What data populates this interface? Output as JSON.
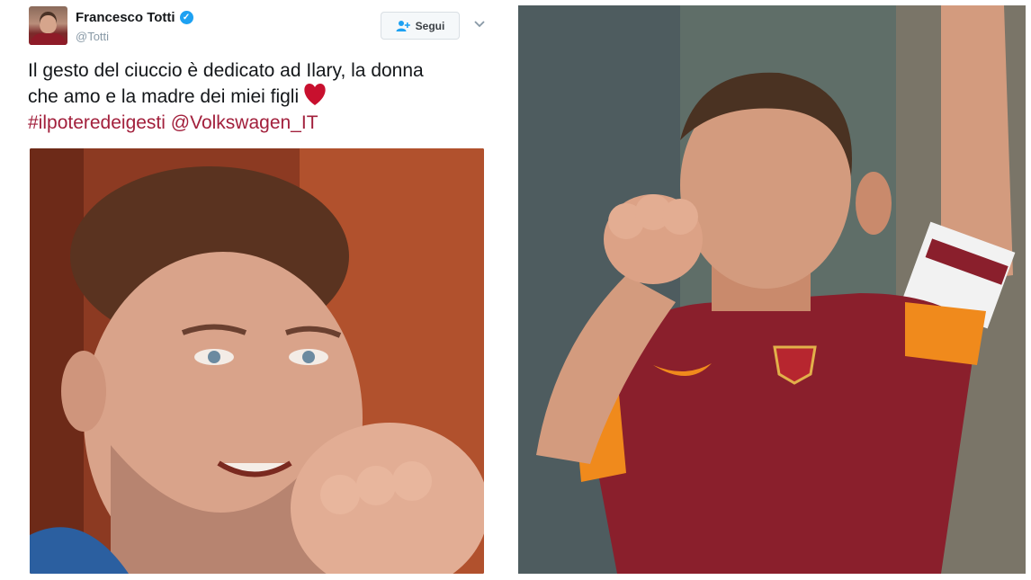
{
  "tweet": {
    "display_name": "Francesco Totti",
    "handle": "@Totti",
    "follow_label": "Segui",
    "text_lines": [
      "Il gesto del ciuccio è dedicato ad Ilary, la donna",
      "che amo e la madre dei miei figli"
    ],
    "hashtag": "#ilpoteredeigesti",
    "mention": "@Volkswagen_IT"
  },
  "icons": {
    "verified": "verified-badge-icon",
    "follow": "add-user-icon",
    "caret": "chevron-down-icon",
    "heart": "red-heart-emoji"
  },
  "colors": {
    "link": "#a2203c",
    "verified": "#1da1f2",
    "heart": "#c8102e"
  }
}
